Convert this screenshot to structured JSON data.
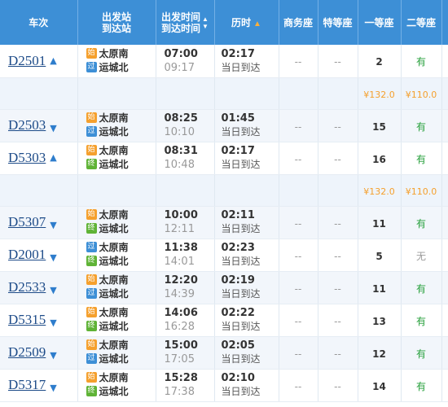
{
  "header": {
    "train_no": "车次",
    "dep_station": "出发站",
    "arr_station": "到达站",
    "dep_time": "出发时间",
    "arr_time": "到达时间",
    "duration": "历时",
    "business": "商务座",
    "special": "特等座",
    "first": "一等座",
    "second": "二等座"
  },
  "badges": {
    "start": "始",
    "pass": "过",
    "end": "终"
  },
  "trains": [
    {
      "no": "D2501",
      "dep": "太原南",
      "arr": "运城北",
      "dep_badge": "始",
      "arr_badge": "过",
      "dep_time": "07:00",
      "arr_time": "09:17",
      "duration": "02:17",
      "arrive_day": "当日到达",
      "business": "--",
      "special": "--",
      "first": "2",
      "second": "有",
      "expanded": true,
      "price_first": "¥132.0",
      "price_second": "¥110.0"
    },
    {
      "no": "D2503",
      "dep": "太原南",
      "arr": "运城北",
      "dep_badge": "始",
      "arr_badge": "过",
      "dep_time": "08:25",
      "arr_time": "10:10",
      "duration": "01:45",
      "arrive_day": "当日到达",
      "business": "--",
      "special": "--",
      "first": "15",
      "second": "有",
      "expanded": false
    },
    {
      "no": "D5303",
      "dep": "太原南",
      "arr": "运城北",
      "dep_badge": "始",
      "arr_badge": "终",
      "dep_time": "08:31",
      "arr_time": "10:48",
      "duration": "02:17",
      "arrive_day": "当日到达",
      "business": "--",
      "special": "--",
      "first": "16",
      "second": "有",
      "expanded": true,
      "price_first": "¥132.0",
      "price_second": "¥110.0"
    },
    {
      "no": "D5307",
      "dep": "太原南",
      "arr": "运城北",
      "dep_badge": "始",
      "arr_badge": "终",
      "dep_time": "10:00",
      "arr_time": "12:11",
      "duration": "02:11",
      "arrive_day": "当日到达",
      "business": "--",
      "special": "--",
      "first": "11",
      "second": "有",
      "expanded": false
    },
    {
      "no": "D2001",
      "dep": "太原南",
      "arr": "运城北",
      "dep_badge": "过",
      "arr_badge": "终",
      "dep_time": "11:38",
      "arr_time": "14:01",
      "duration": "02:23",
      "arrive_day": "当日到达",
      "business": "--",
      "special": "--",
      "first": "5",
      "second": "无",
      "expanded": false
    },
    {
      "no": "D2533",
      "dep": "太原南",
      "arr": "运城北",
      "dep_badge": "始",
      "arr_badge": "过",
      "dep_time": "12:20",
      "arr_time": "14:39",
      "duration": "02:19",
      "arrive_day": "当日到达",
      "business": "--",
      "special": "--",
      "first": "11",
      "second": "有",
      "expanded": false
    },
    {
      "no": "D5315",
      "dep": "太原南",
      "arr": "运城北",
      "dep_badge": "始",
      "arr_badge": "终",
      "dep_time": "14:06",
      "arr_time": "16:28",
      "duration": "02:22",
      "arrive_day": "当日到达",
      "business": "--",
      "special": "--",
      "first": "13",
      "second": "有",
      "expanded": false
    },
    {
      "no": "D2509",
      "dep": "太原南",
      "arr": "运城北",
      "dep_badge": "始",
      "arr_badge": "过",
      "dep_time": "15:00",
      "arr_time": "17:05",
      "duration": "02:05",
      "arrive_day": "当日到达",
      "business": "--",
      "special": "--",
      "first": "12",
      "second": "有",
      "expanded": false
    },
    {
      "no": "D5317",
      "dep": "太原南",
      "arr": "运城北",
      "dep_badge": "始",
      "arr_badge": "终",
      "dep_time": "15:28",
      "arr_time": "17:38",
      "duration": "02:10",
      "arrive_day": "当日到达",
      "business": "--",
      "special": "--",
      "first": "14",
      "second": "有",
      "expanded": false
    }
  ],
  "colors": {
    "header_bg": "#3d8fd6",
    "train_link": "#1d4b88",
    "available": "#27a03c",
    "price": "#f5a02d",
    "badge_start": "#f5a02d",
    "badge_pass": "#3d8fd6",
    "badge_end": "#5fb336"
  },
  "icons": {
    "sort_up": "sort-up-icon",
    "sort_down": "sort-down-icon",
    "collapse": "chevron-up-icon",
    "expand": "chevron-down-icon"
  }
}
